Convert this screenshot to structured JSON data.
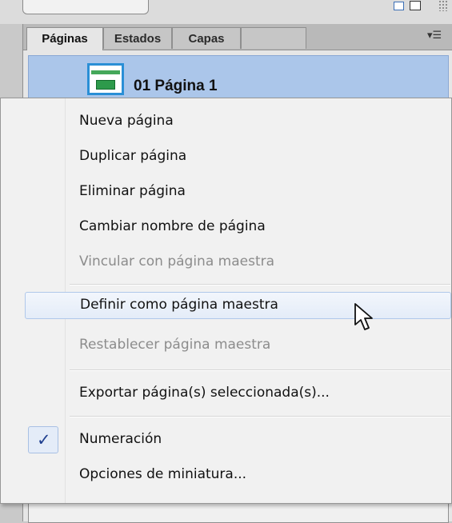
{
  "panel": {
    "tabs": [
      {
        "label": "Páginas"
      },
      {
        "label": "Estados"
      },
      {
        "label": "Capas"
      }
    ],
    "page_row": {
      "label": "01  Página 1"
    }
  },
  "menu": {
    "items": [
      {
        "label": "Nueva página",
        "enabled": true
      },
      {
        "label": "Duplicar página",
        "enabled": true
      },
      {
        "label": "Eliminar página",
        "enabled": true
      },
      {
        "label": "Cambiar nombre de página",
        "enabled": true
      },
      {
        "label": "Vincular con página maestra",
        "enabled": false
      },
      {
        "label": "Definir como página maestra",
        "enabled": true,
        "hovered": true
      },
      {
        "label": "Restablecer página maestra",
        "enabled": false
      },
      {
        "label": "Exportar página(s) seleccionada(s)...",
        "enabled": true
      },
      {
        "label": "Numeración",
        "enabled": true,
        "checked": true
      },
      {
        "label": "Opciones de miniatura...",
        "enabled": true
      }
    ]
  },
  "icons": {
    "panel_menu": "panel-options-icon",
    "check": "checkmark-icon",
    "cursor": "mouse-pointer-icon"
  },
  "colors": {
    "selection": "#abc6ea",
    "hover": "#e4ecf8",
    "disabled_text": "#8c8c8c"
  }
}
